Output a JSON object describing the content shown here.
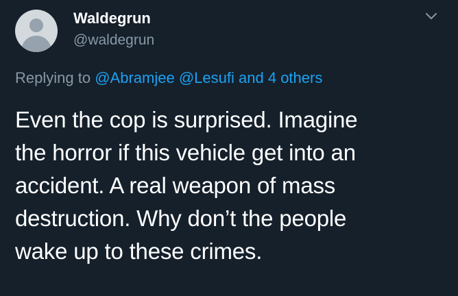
{
  "author": {
    "display_name": "Waldegrun",
    "handle": "@waldegrun",
    "avatar_icon": "default-user-avatar"
  },
  "menu": {
    "icon": "chevron-down-icon"
  },
  "reply_context": {
    "prefix": "Replying to",
    "mentions": [
      "@Abramjee",
      "@Lesufi"
    ],
    "connector": "and",
    "others": "4 others"
  },
  "tweet": {
    "lines": [
      "Even the cop is surprised. Imagine",
      "the horror if this vehicle get into an",
      "accident. A real weapon of mass",
      "destruction. Why don’t the people",
      "wake up to these crimes."
    ]
  },
  "colors": {
    "background": "#15202b",
    "secondary_text": "#8899a6",
    "link": "#1da1f2",
    "primary_text": "#ffffff"
  }
}
